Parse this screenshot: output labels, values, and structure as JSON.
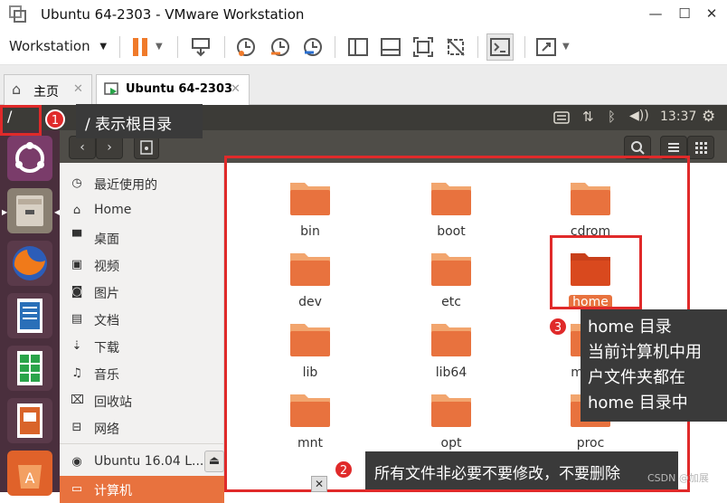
{
  "window": {
    "title": "Ubuntu 64-2303 - VMware Workstation",
    "minimize_glyph": "—",
    "maximize_glyph": "☐",
    "close_glyph": "✕"
  },
  "toolbar": {
    "workstation_label": "Workstation",
    "dropdown_glyph": "▼"
  },
  "tabs": [
    {
      "label": "主页",
      "close_glyph": "✕"
    },
    {
      "label": "Ubuntu 64-2303",
      "close_glyph": "✕"
    }
  ],
  "ubuntu_panel": {
    "path_label": "/",
    "clock": "13:37"
  },
  "nautilus": {
    "back_glyph": "‹",
    "forward_glyph": "›",
    "search_glyph": "⌕",
    "list_glyph": "≡",
    "grid_glyph": "⋮⋮"
  },
  "sidebar": {
    "items": [
      {
        "icon": "clock-icon",
        "glyph": "◷",
        "label": "最近使用的"
      },
      {
        "icon": "home-icon",
        "glyph": "⌂",
        "label": "Home"
      },
      {
        "icon": "folder-icon",
        "glyph": "▀",
        "label": "桌面"
      },
      {
        "icon": "video-icon",
        "glyph": "▣",
        "label": "视频"
      },
      {
        "icon": "camera-icon",
        "glyph": "◙",
        "label": "图片"
      },
      {
        "icon": "document-icon",
        "glyph": "▤",
        "label": "文档"
      },
      {
        "icon": "download-icon",
        "glyph": "⇣",
        "label": "下载"
      },
      {
        "icon": "music-icon",
        "glyph": "♫",
        "label": "音乐"
      },
      {
        "icon": "trash-icon",
        "glyph": "⌧",
        "label": "回收站"
      },
      {
        "icon": "network-icon",
        "glyph": "⊟",
        "label": "网络"
      }
    ],
    "drive_label": "Ubuntu 16.04 L...",
    "eject_glyph": "⏏",
    "computer_label": "计算机"
  },
  "folders": [
    "bin",
    "boot",
    "cdrom",
    "dev",
    "etc",
    "home",
    "lib",
    "lib64",
    "media",
    "mnt",
    "opt",
    "proc"
  ],
  "selected_folder": "home",
  "annotations": {
    "badge1": "1",
    "badge2": "2",
    "badge3": "3",
    "callout1": "/ 表示根目录",
    "callout2": "所有文件非必要不要修改，不要删除",
    "callout3_lines": [
      "home 目录",
      "当前计算机中用",
      "户文件夹都在",
      "home 目录中"
    ],
    "watermark": "CSDN @加展"
  },
  "colors": {
    "accent_red": "#e02a2a",
    "folder_orange": "#e8723e",
    "launcher_bg": "#4a2f3d",
    "panel_bg": "#3c3b37"
  }
}
